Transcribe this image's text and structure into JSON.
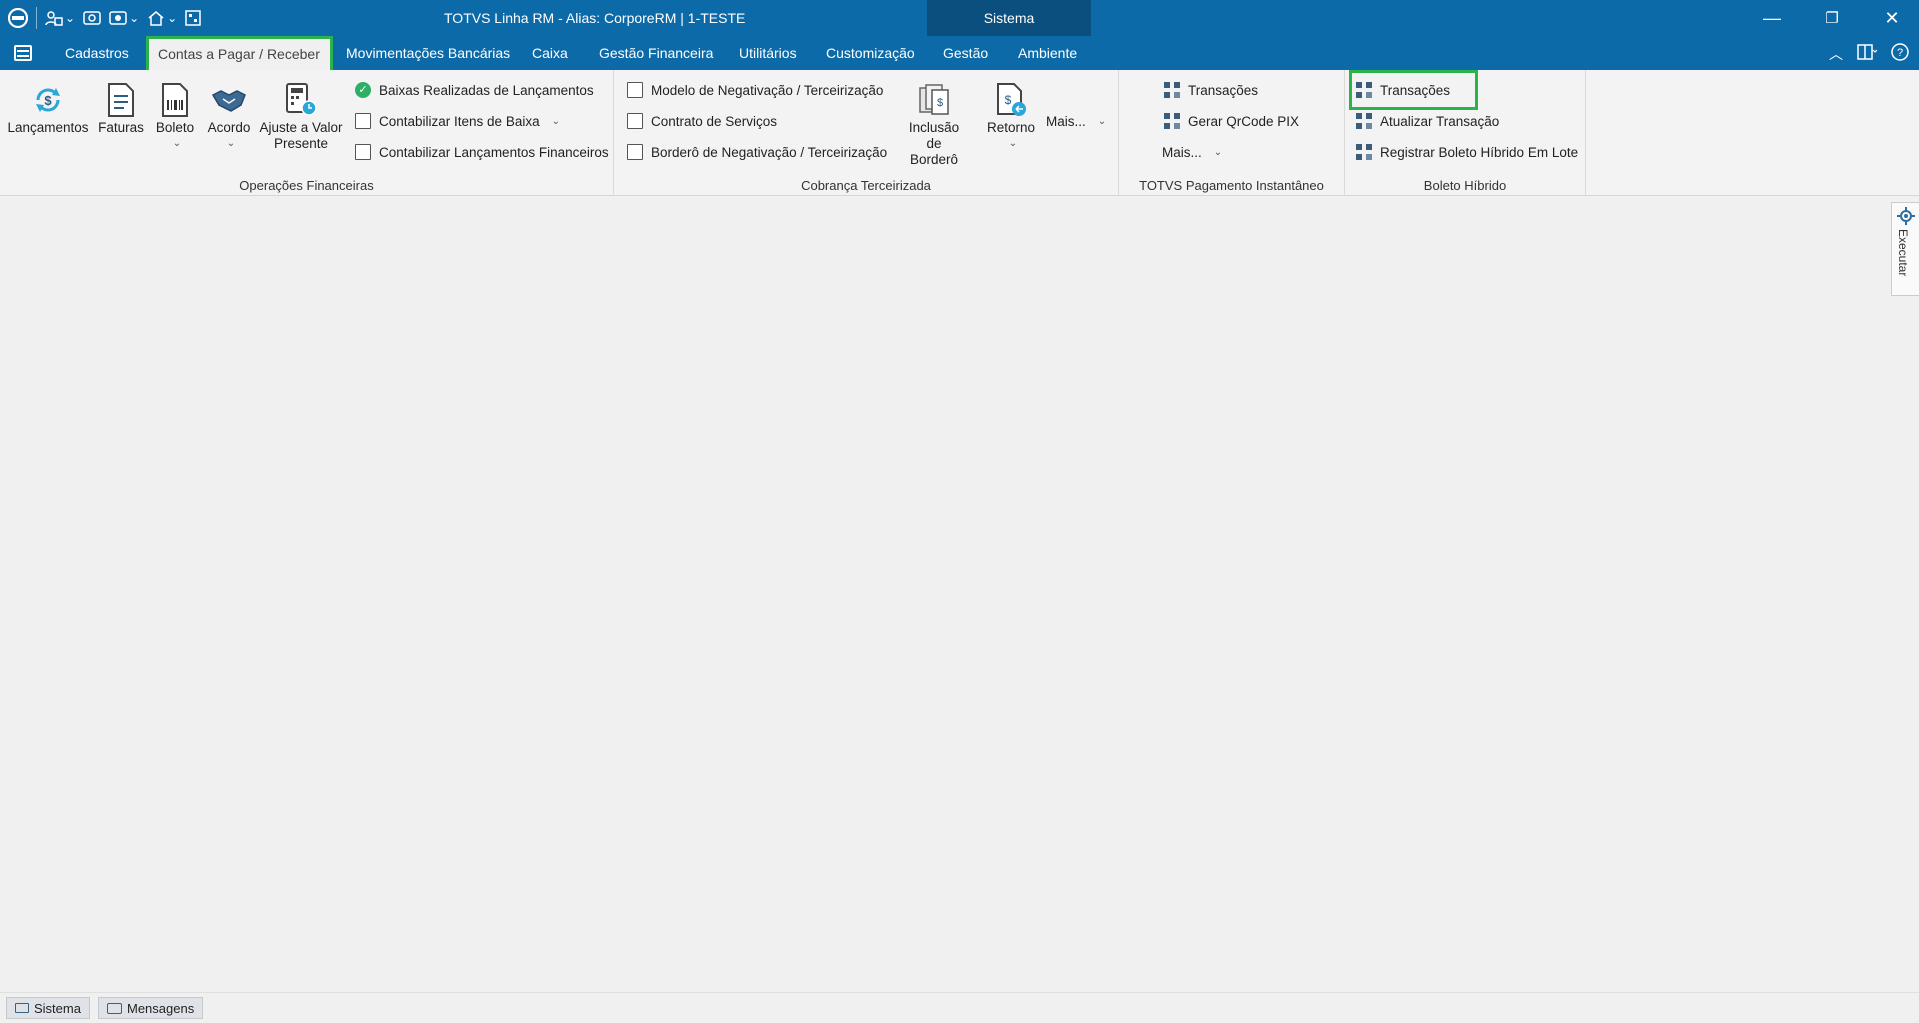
{
  "titlebar": {
    "title": "TOTVS Linha RM -  Alias: CorporeRM | 1-TESTE",
    "context_tab": "Sistema",
    "qat_icons": [
      "app-logo-icon",
      "users-icon",
      "eye-icon",
      "window-icon",
      "home-icon",
      "grid-icon"
    ],
    "controls": [
      "minimize",
      "restore",
      "close"
    ]
  },
  "menubar": {
    "tabs": [
      {
        "label": "Cadastros"
      },
      {
        "label": "Contas a Pagar / Receber"
      },
      {
        "label": "Movimentações Bancárias"
      },
      {
        "label": "Caixa"
      },
      {
        "label": "Gestão Financeira"
      },
      {
        "label": "Utilitários"
      },
      {
        "label": "Customização"
      },
      {
        "label": "Gestão"
      },
      {
        "label": "Ambiente"
      }
    ],
    "active_tab": "Contas a Pagar / Receber",
    "highlight_color": "#29b34a"
  },
  "ribbon": {
    "groups": [
      {
        "label": "Operações Financeiras",
        "big_buttons": [
          "Lançamentos",
          "Faturas",
          "Boleto",
          "Acordo",
          "Ajuste a Valor Presente"
        ],
        "small_buttons": [
          "Baixas Realizadas de Lançamentos",
          "Contabilizar Itens de Baixa",
          "Contabilizar Lançamentos Financeiros"
        ]
      },
      {
        "label": "Cobrança Terceirizada",
        "small_buttons": [
          "Modelo de Negativação / Terceirização",
          "Contrato de Serviços",
          "Borderô de Negativação / Terceirização"
        ],
        "big_buttons": [
          "Inclusão de Borderô",
          "Retorno",
          "Mais..."
        ]
      },
      {
        "label": "TOTVS Pagamento Instantâneo",
        "small_buttons": [
          "Transações",
          "Gerar QrCode PIX",
          "Mais..."
        ]
      },
      {
        "label": "Boleto Híbrido",
        "small_buttons": [
          "Transações",
          "Atualizar Transação",
          "Registrar Boleto Híbrido Em Lote"
        ]
      }
    ]
  },
  "side_panel": {
    "label": "Executar"
  },
  "statusbar": {
    "buttons": [
      "Sistema",
      "Mensagens"
    ]
  },
  "colors": {
    "titlebar": "#0d6aa8",
    "context_tab": "#0b4f7e",
    "ribbon_bg": "#f3f3f3",
    "highlight": "#29b34a"
  }
}
